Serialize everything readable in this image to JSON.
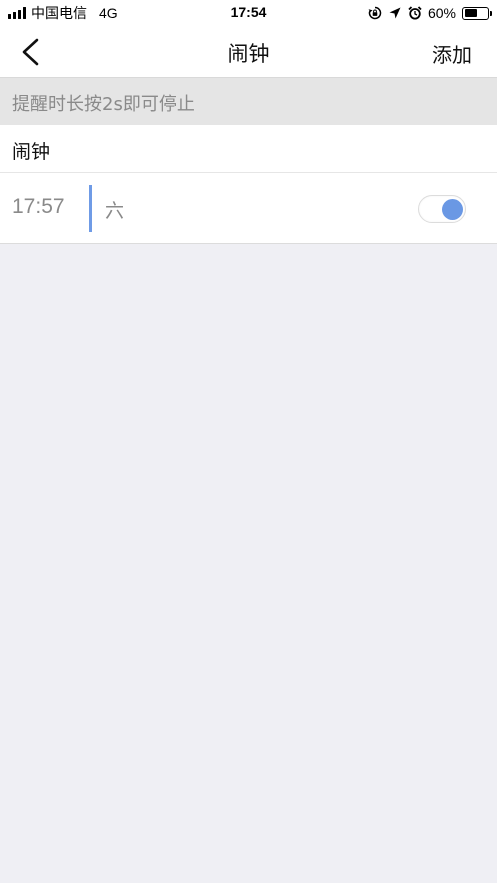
{
  "status_bar": {
    "carrier": "中国电信",
    "network": "4G",
    "time": "17:54",
    "battery_percent_label": "60%",
    "battery_level": 0.6,
    "icons": [
      "signal-icon",
      "rotation-lock-icon",
      "location-icon",
      "alarm-clock-icon",
      "battery-icon"
    ]
  },
  "nav": {
    "back_icon": "chevron-left-icon",
    "title": "闹钟",
    "add_label": "添加"
  },
  "hint": {
    "text": "提醒时长按2s即可停止"
  },
  "section": {
    "title": "闹钟"
  },
  "alarms": [
    {
      "time": "17:57",
      "days": "六",
      "enabled": true
    }
  ],
  "colors": {
    "accent": "#6a98e4",
    "divider_accent": "#6f9be6",
    "background": "#efeff4",
    "hint_bg": "#e5e5e5",
    "muted_text": "#8a8a8a"
  }
}
